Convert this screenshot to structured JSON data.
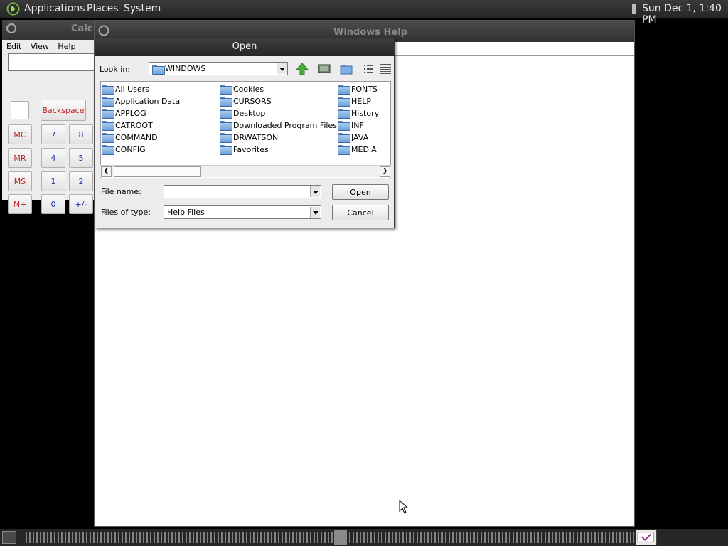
{
  "top_panel": {
    "menus": [
      "Applications",
      "Places",
      "System"
    ],
    "clock": "Sun Dec 1,  1:40 PM"
  },
  "calculator": {
    "title": "Calc",
    "menu": [
      "Edit",
      "View",
      "Help"
    ],
    "buttons": {
      "backspace": "Backspace",
      "mc": "MC",
      "mr": "MR",
      "ms": "MS",
      "mplus": "M+",
      "seven": "7",
      "eight": "8",
      "four": "4",
      "five": "5",
      "one": "1",
      "two": "2",
      "zero": "0",
      "sign": "+/-"
    }
  },
  "help_window": {
    "title": "Windows Help"
  },
  "open_dialog": {
    "title": "Open",
    "look_in_label": "Look in:",
    "look_in_value": "WINDOWS",
    "files": [
      "All Users",
      "Application Data",
      "APPLOG",
      "CATROOT",
      "COMMAND",
      "CONFIG",
      "Cookies",
      "CURSORS",
      "Desktop",
      "Downloaded Program Files",
      "DRWATSON",
      "Favorites",
      "FONTS",
      "HELP",
      "History",
      "INF",
      "JAVA",
      "MEDIA"
    ],
    "file_name_label": "File name:",
    "file_name_value": "",
    "files_of_type_label": "Files of type:",
    "files_of_type_value": "Help Files",
    "open_button": "Open",
    "cancel_button": "Cancel"
  }
}
